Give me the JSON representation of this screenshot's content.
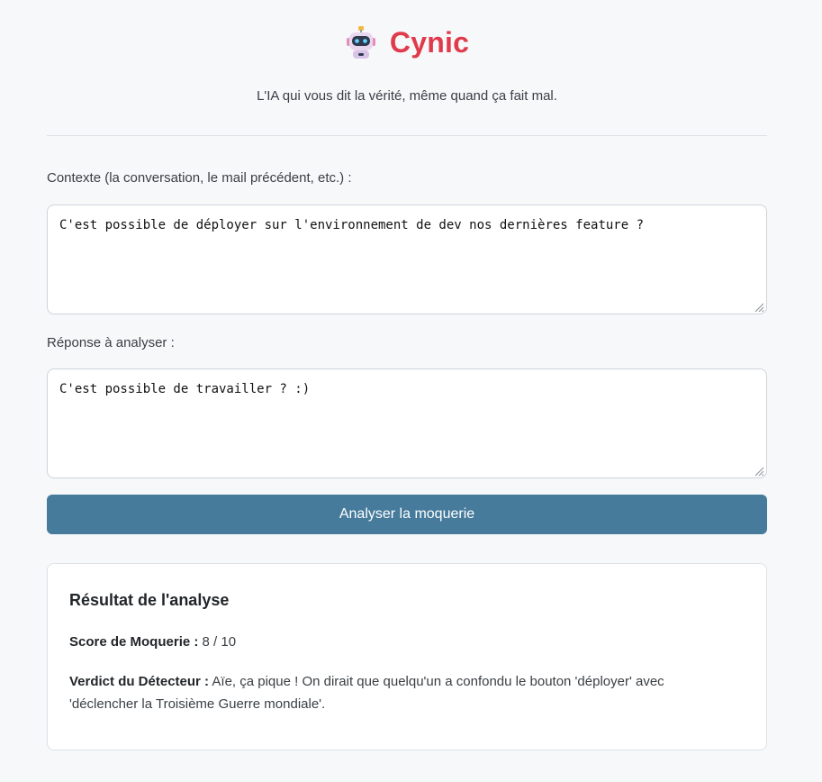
{
  "header": {
    "icon": "robot-icon",
    "title": "Cynic",
    "tagline": "L'IA qui vous dit la vérité, même quand ça fait mal."
  },
  "form": {
    "context_label": "Contexte (la conversation, le mail précédent, etc.) :",
    "context_value": "C'est possible de déployer sur l'environnement de dev nos dernières feature ?",
    "response_label": "Réponse à analyser :",
    "response_value": "C'est possible de travailler ? :)",
    "submit_label": "Analyser la moquerie"
  },
  "result": {
    "title": "Résultat de l'analyse",
    "score_label": "Score de Moquerie :",
    "score_value": "8 / 10",
    "verdict_label": "Verdict du Détecteur :",
    "verdict_text": "Aïe, ça pique ! On dirait que quelqu'un a confondu le bouton 'déployer' avec 'déclencher la Troisième Guerre mondiale'."
  },
  "colors": {
    "brand": "#e03b4b",
    "button": "#467b9c",
    "background": "#f6f8fa"
  }
}
